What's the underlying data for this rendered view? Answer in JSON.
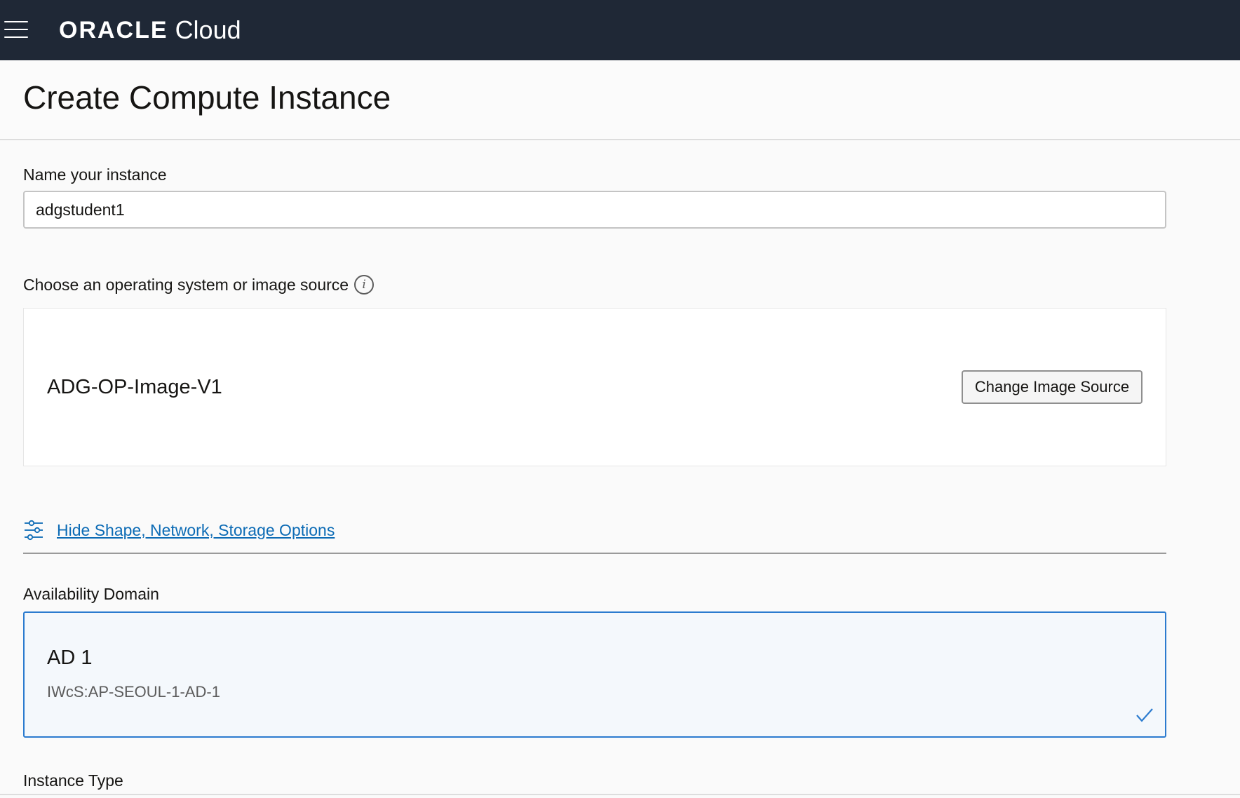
{
  "header": {
    "brand": "ORACLE",
    "product": "Cloud"
  },
  "page": {
    "title": "Create Compute Instance"
  },
  "form": {
    "name_label": "Name your instance",
    "name_value": "adgstudent1",
    "os_label": "Choose an operating system or image source",
    "info_glyph": "i",
    "image": {
      "name": "ADG-OP-Image-V1",
      "change_label": "Change Image Source"
    },
    "options_toggle": "Hide Shape, Network, Storage Options",
    "availability_domain": {
      "label": "Availability Domain",
      "name": "AD 1",
      "id": "IWcS:AP-SEOUL-1-AD-1",
      "selected": true
    },
    "instance_type_label": "Instance Type"
  },
  "colors": {
    "topbar": "#1f2836",
    "link": "#0c6bb5",
    "selected_border": "#2b7bcf",
    "selected_bg": "#f4f8fc"
  },
  "icons": [
    "hamburger-menu-icon",
    "info-icon",
    "sliders-icon",
    "checkmark-icon"
  ]
}
